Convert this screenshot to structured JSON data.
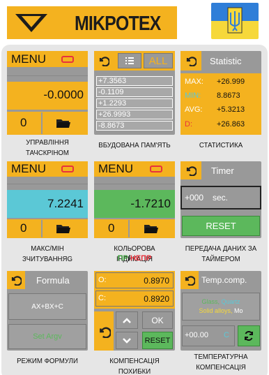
{
  "header": {
    "brand": "MIKPOTEX",
    "flag": "ukraine-flag"
  },
  "colors": {
    "accent": "#f4b21f",
    "panel": "#999999",
    "cyan": "#5bc8d6",
    "green": "#5cb85c",
    "red": "#e8323c"
  },
  "p1": {
    "menu": "MENU",
    "value": "-0.0000",
    "count": "0",
    "caption": "УПРАВЛІННЯ ТАЧСКРІНОМ"
  },
  "p2": {
    "all": "ALL",
    "rows": [
      "+7.3563",
      "-0.1109",
      "+1.2293",
      "+26.9993",
      "-8.8673"
    ],
    "caption": "ВБУДОВАНА ПАМ'ЯТЬ"
  },
  "p3": {
    "title": "Statistic",
    "max_l": "MAX:",
    "max_v": "+26.999",
    "min_l": "MIN:",
    "min_v": "8.8673",
    "avg_l": "AVG:",
    "avg_v": "+5.3213",
    "d_l": "D:",
    "d_v": "+26.863",
    "caption": "СТАТИСТИКА"
  },
  "p4": {
    "menu": "MENU",
    "value": "7.2241",
    "count": "0",
    "caption": "МАКС/МІН ЗЧИТУВАННЯG"
  },
  "p5": {
    "menu": "MENU",
    "value": "-1.7210",
    "count": "0",
    "caption": "КОЛЬОРОВА ІНДИКАЦІЯ",
    "tag_pass": "ПР",
    "tag_sep": "/",
    "tag_fail": "НЕПР"
  },
  "p6": {
    "title": "Timer",
    "value": "+000",
    "unit": "sec.",
    "reset": "RESET",
    "caption": "ПЕРЕДАЧА ДАНИХ ЗА ТАЙМЕРОМ"
  },
  "p7": {
    "title": "Formula",
    "formula": "AX+BX+C",
    "set": "Set Argv",
    "caption": "РЕЖИМ ФОРМУЛИ"
  },
  "p8": {
    "o_l": "O:",
    "o_v": "0.8970",
    "c_l": "C:",
    "c_v": "0.8920",
    "ok": "OK",
    "reset": "RESET",
    "caption": "КОМПЕНСАЦІЯ ПОХИБКИ"
  },
  "p9": {
    "title": "Temp.comp.",
    "mat1": "Glass,",
    "mat2": "Quartz",
    "mat3": "Solid alloys,",
    "mat4": "Mo",
    "value": "+00.00",
    "unit": "C",
    "caption": "ТЕМПЕРАТУРНА КОМПЕНСАЦІЯ"
  }
}
